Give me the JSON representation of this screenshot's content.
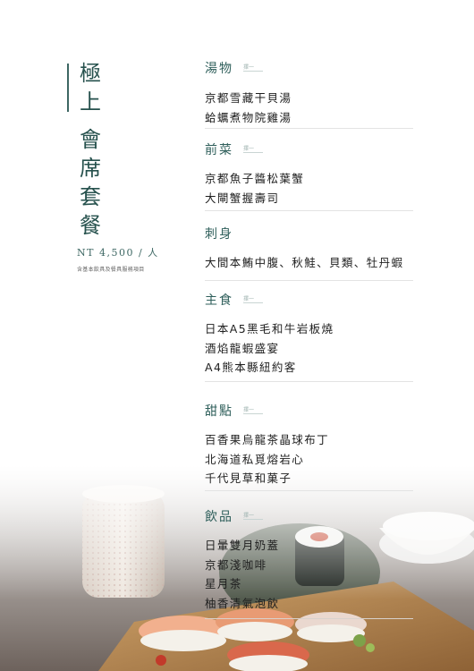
{
  "title": {
    "chars": [
      "極",
      "上",
      "會",
      "席",
      "套",
      "餐"
    ],
    "price": "NT 4,500 / 人",
    "note": "含基本飲具及餐具服務項目"
  },
  "sections": [
    {
      "title": "湯物",
      "tag": "擇一",
      "items": [
        "京都雪藏干貝湯",
        "蛤蠣煮物院雞湯"
      ]
    },
    {
      "title": "前菜",
      "tag": "擇一",
      "items": [
        "京都魚子醬松葉蟹",
        "大閘蟹握壽司"
      ]
    },
    {
      "title": "刺身",
      "tag": "",
      "items": [
        "大間本鮪中腹、秋鮭、貝類、牡丹蝦"
      ]
    },
    {
      "title": "主食",
      "tag": "擇一",
      "items": [
        "日本A5黑毛和牛岩板燒",
        "酒焰龍蝦盛宴",
        "A4熊本縣紐約客"
      ]
    },
    {
      "title": "甜點",
      "tag": "擇一",
      "items": [
        "百香果烏龍茶晶球布丁",
        "北海道私覓熔岩心",
        "千代見草和菓子"
      ]
    },
    {
      "title": "飲品",
      "tag": "擇一",
      "items": [
        "日暈雙月奶蓋",
        "京都淺咖啡",
        "星月茶",
        "柚香清氣泡飲"
      ]
    }
  ],
  "colors": {
    "accent": "#2f5f5b",
    "rule": "#e3e3e3",
    "text": "#1f1f1f"
  }
}
